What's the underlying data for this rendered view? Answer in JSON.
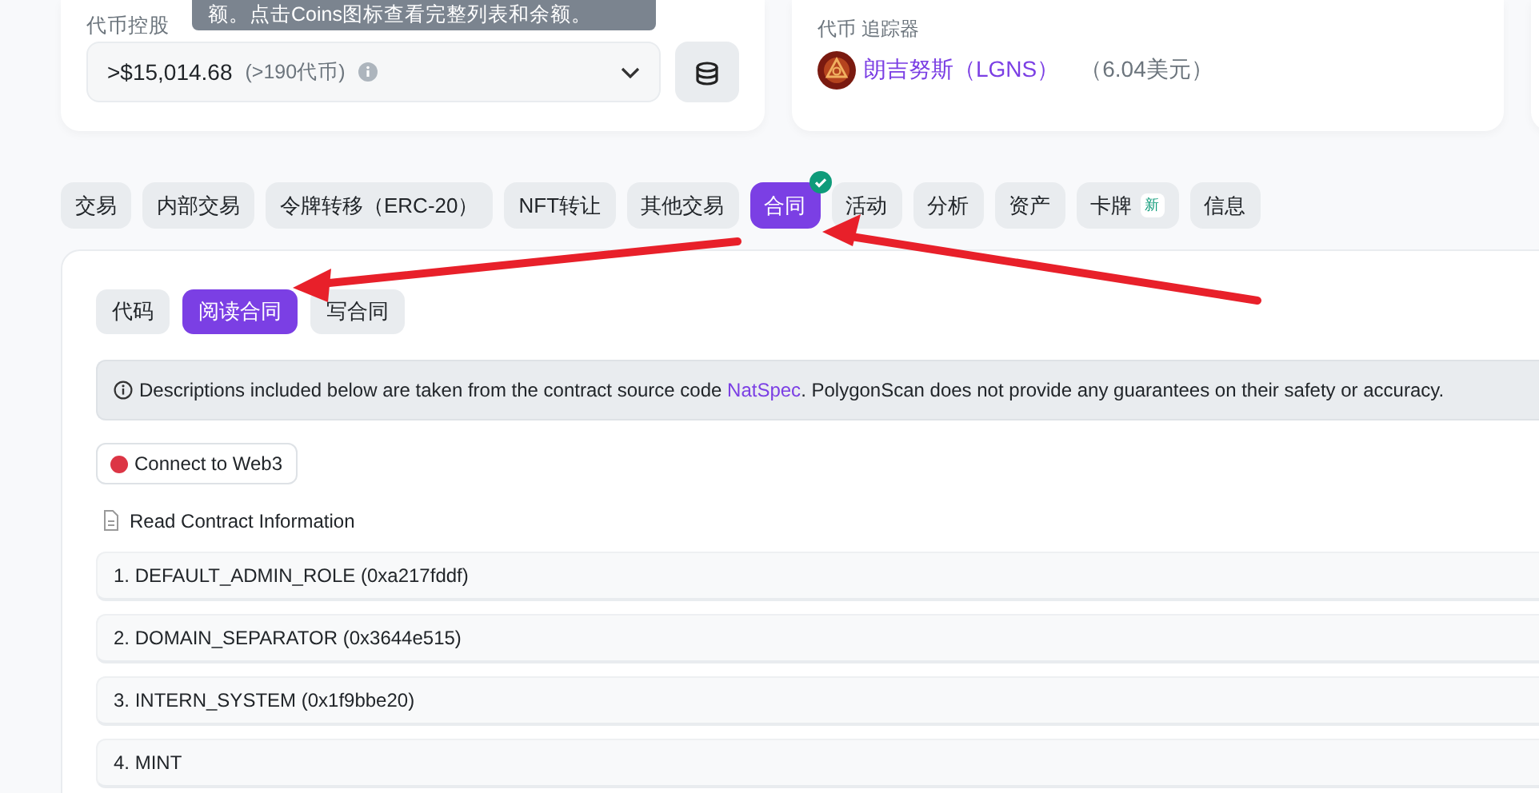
{
  "tooltip": {
    "text": "额。点击Coins图标查看完整列表和余额。"
  },
  "holdings": {
    "label": "代币控股",
    "value": ">$15,014.68",
    "count": "(>190代币)"
  },
  "tracker": {
    "label": "代币 追踪器",
    "token": "朗吉努斯（LGNS）",
    "price": "（6.04美元）"
  },
  "tabs": [
    {
      "label": "交易",
      "selected": false,
      "verified": false
    },
    {
      "label": "内部交易",
      "selected": false,
      "verified": false
    },
    {
      "label": "令牌转移（ERC-20）",
      "selected": false,
      "verified": false
    },
    {
      "label": "NFT转让",
      "selected": false,
      "verified": false
    },
    {
      "label": "其他交易",
      "selected": false,
      "verified": false
    },
    {
      "label": "合同",
      "selected": true,
      "verified": true
    },
    {
      "label": "活动",
      "selected": false,
      "verified": false
    },
    {
      "label": "分析",
      "selected": false,
      "verified": false
    },
    {
      "label": "资产",
      "selected": false,
      "verified": false
    },
    {
      "label": "卡牌",
      "selected": false,
      "verified": false,
      "badge": "新"
    },
    {
      "label": "信息",
      "selected": false,
      "verified": false
    }
  ],
  "subtabs": [
    {
      "label": "代码",
      "selected": false
    },
    {
      "label": "阅读合同",
      "selected": true
    },
    {
      "label": "写合同",
      "selected": false
    }
  ],
  "notice": {
    "text": "Descriptions included below are taken from the contract source code ",
    "link": "NatSpec",
    "rest": ". PolygonScan does not provide any guarantees on their safety or accuracy."
  },
  "connect": {
    "label": "Connect to Web3",
    "connected": false
  },
  "section_title": "Read Contract Information",
  "functions": [
    "1. DEFAULT_ADMIN_ROLE (0xa217fddf)",
    "2. DOMAIN_SEPARATOR (0x3644e515)",
    "3. INTERN_SYSTEM (0x1f9bbe20)",
    "4. MINT"
  ]
}
